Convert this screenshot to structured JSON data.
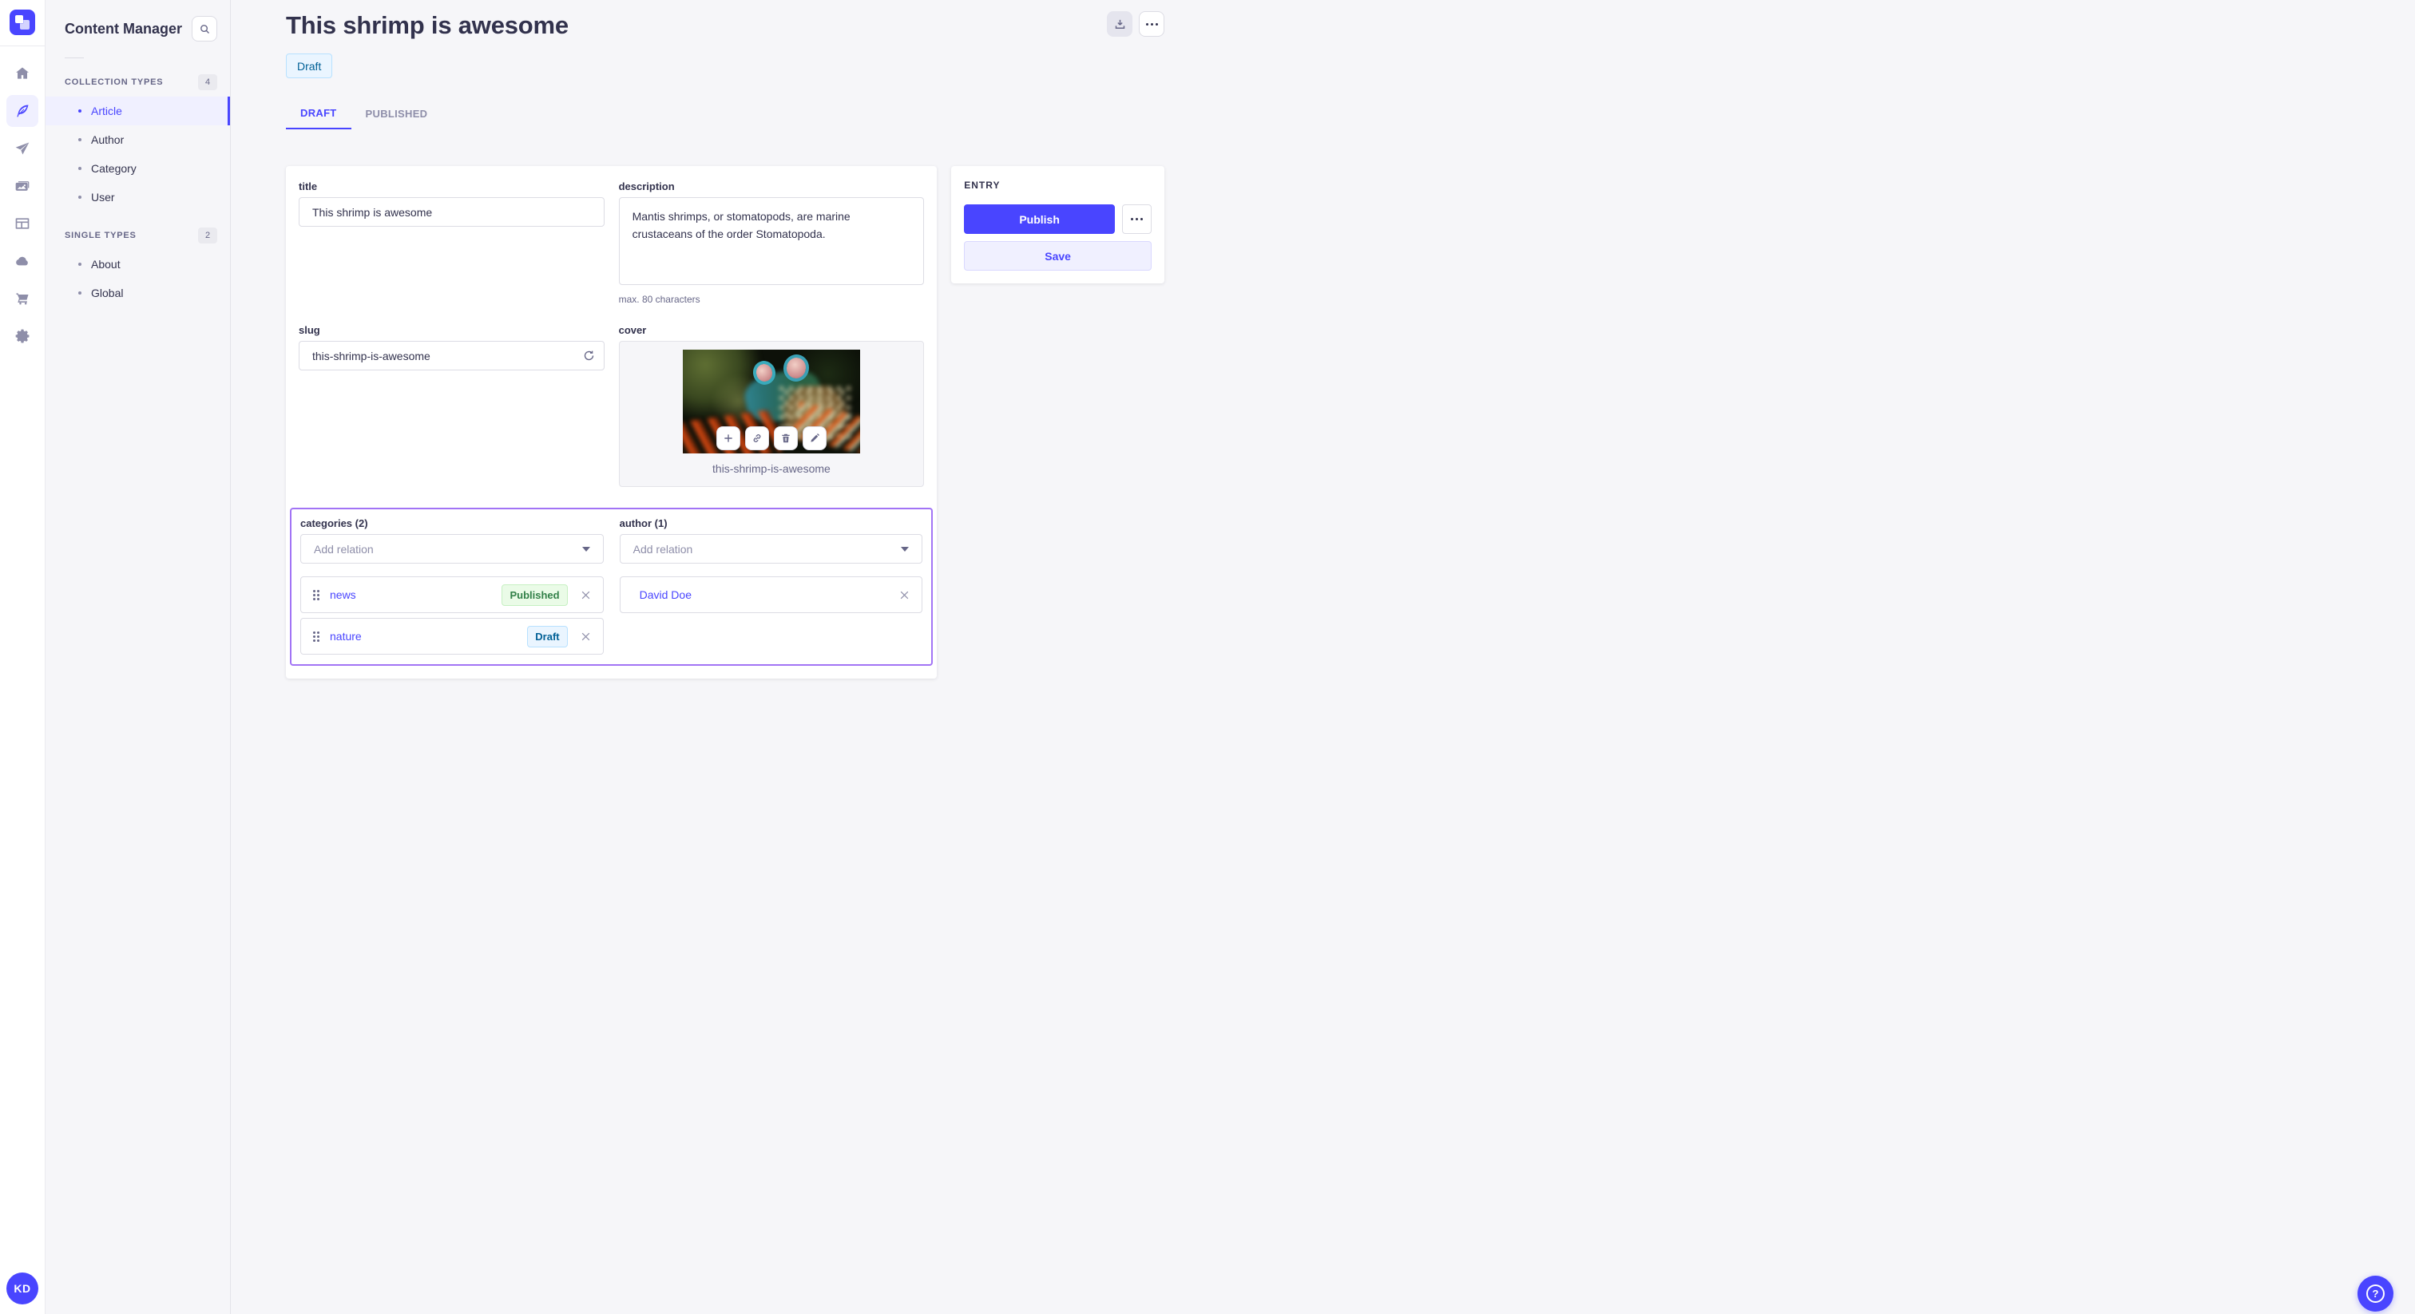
{
  "rail": {
    "icons": [
      {
        "name": "home",
        "active": false
      },
      {
        "name": "content-manager-feather",
        "active": true
      },
      {
        "name": "release-plane",
        "active": false
      },
      {
        "name": "media-library",
        "active": false
      },
      {
        "name": "content-type-builder",
        "active": false
      },
      {
        "name": "deploy-cloud",
        "active": false
      },
      {
        "name": "marketplace-cart",
        "active": false
      },
      {
        "name": "settings-gear",
        "active": false
      }
    ],
    "avatar_initials": "KD"
  },
  "sidebar": {
    "title": "Content Manager",
    "sections": [
      {
        "label": "COLLECTION TYPES",
        "count": "4",
        "items": [
          {
            "label": "Article",
            "active": true
          },
          {
            "label": "Author",
            "active": false
          },
          {
            "label": "Category",
            "active": false
          },
          {
            "label": "User",
            "active": false
          }
        ]
      },
      {
        "label": "SINGLE TYPES",
        "count": "2",
        "items": [
          {
            "label": "About",
            "active": false
          },
          {
            "label": "Global",
            "active": false
          }
        ]
      }
    ]
  },
  "header": {
    "title": "This shrimp is awesome",
    "status_badge": "Draft",
    "tabs": [
      {
        "label": "DRAFT",
        "active": true
      },
      {
        "label": "PUBLISHED",
        "active": false
      }
    ]
  },
  "form": {
    "title": {
      "label": "title",
      "value": "This shrimp is awesome"
    },
    "description": {
      "label": "description",
      "value": "Mantis shrimps, or stomatopods, are marine crustaceans of the order Stomatopoda.",
      "hint": "max. 80 characters"
    },
    "slug": {
      "label": "slug",
      "value": "this-shrimp-is-awesome"
    },
    "cover": {
      "label": "cover",
      "caption": "this-shrimp-is-awesome"
    },
    "categories": {
      "label": "categories (2)",
      "placeholder": "Add relation",
      "relations": [
        {
          "name": "news",
          "status": "Published"
        },
        {
          "name": "nature",
          "status": "Draft"
        }
      ]
    },
    "author": {
      "label": "author (1)",
      "placeholder": "Add relation",
      "relations": [
        {
          "name": "David Doe"
        }
      ]
    }
  },
  "entry_panel": {
    "title": "ENTRY",
    "publish_label": "Publish",
    "save_label": "Save"
  },
  "help": {
    "glyph": "?"
  },
  "colors": {
    "primary": "#4945ff",
    "primary_light": "#f0f0ff",
    "relation_highlight": "#a274f5",
    "draft_bg": "#eaf5ff",
    "draft_border": "#b8e1ff",
    "draft_text": "#006096",
    "published_bg": "#eafbe7",
    "published_border": "#c6f0c2",
    "published_text": "#328048",
    "page_bg": "#f6f6f9",
    "text": "#32324d",
    "muted": "#666687",
    "border": "#dcdce4"
  }
}
